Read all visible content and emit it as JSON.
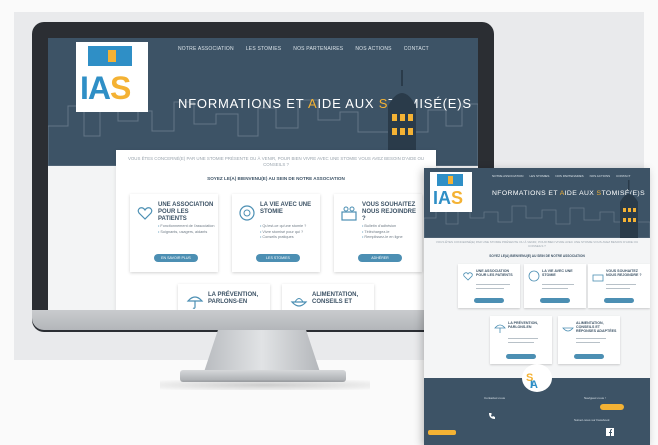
{
  "site": {
    "nav": [
      "NOTRE ASSOCIATION",
      "LES STOMIES",
      "NOS PARTENAIRES",
      "NOS ACTIONS",
      "CONTACT"
    ],
    "title": {
      "part1": "NFORMATIONS ET ",
      "a": "A",
      "part2": "IDE AUX ",
      "s": "S",
      "part3": "TOMISÉ(E)S"
    },
    "logo_letters": {
      "i": "I",
      "a": "A",
      "s": "S"
    },
    "intro": "VOUS ÊTES CONCERNÉ(E) PAR UNE STOMIE PRÉSENTE OU À VENIR, POUR BIEN VIVRE AVEC UNE STOMIE VOUS AVEZ BESOIN D'AIDE OU CONSEILS ?",
    "welcome": "SOYEZ LE(A) BIENVENU(E) AU SEIN DE NOTRE ASSOCIATION",
    "cards": [
      {
        "title": "UNE ASSOCIATION POUR LES PATIENTS",
        "items": [
          "Fonctionnement de l'association",
          "Soignants, usagers, aidants"
        ],
        "button": "EN SAVOIR PLUS"
      },
      {
        "title": "LA VIE AVEC UNE STOMIE",
        "items": [
          "Qu'est-ce qu'une stomie ?",
          "Vivre stomisé pour qui ?",
          "Conseils pratiques"
        ],
        "button": "LES STOMIES"
      },
      {
        "title": "VOUS SOUHAITEZ NOUS REJOINDRE ?",
        "items": [
          "Bulletin d'adhésion",
          "Téléchargez-le",
          "Remplissez-le en ligne"
        ],
        "button": "ADHÉRER"
      }
    ],
    "cards_bottom": [
      {
        "title": "LA PRÉVENTION, PARLONS-EN"
      },
      {
        "title": "ALIMENTATION, CONSEILS ET"
      }
    ],
    "colors": {
      "primary": "#3d5366",
      "accent": "#f4b234",
      "blue": "#2f8fc6",
      "button": "#4c8fb3"
    }
  },
  "mobile": {
    "cards": [
      {
        "title": "UNE ASSOCIATION POUR LES PATIENTS"
      },
      {
        "title": "LA VIE AVEC UNE STOMIE"
      },
      {
        "title": "VOUS SOUHAITEZ NOUS REJOINDRE ?"
      },
      {
        "title": "LA PRÉVENTION, PARLONS-EN"
      },
      {
        "title": "ALIMENTATION, CONSEILS ET RÉPONSES ADAPTÉES"
      }
    ],
    "footer": {
      "contact": "Contactez-nous",
      "follow": "Naviguez-nous !",
      "social": "Suivez-nous sur Facebook"
    }
  }
}
